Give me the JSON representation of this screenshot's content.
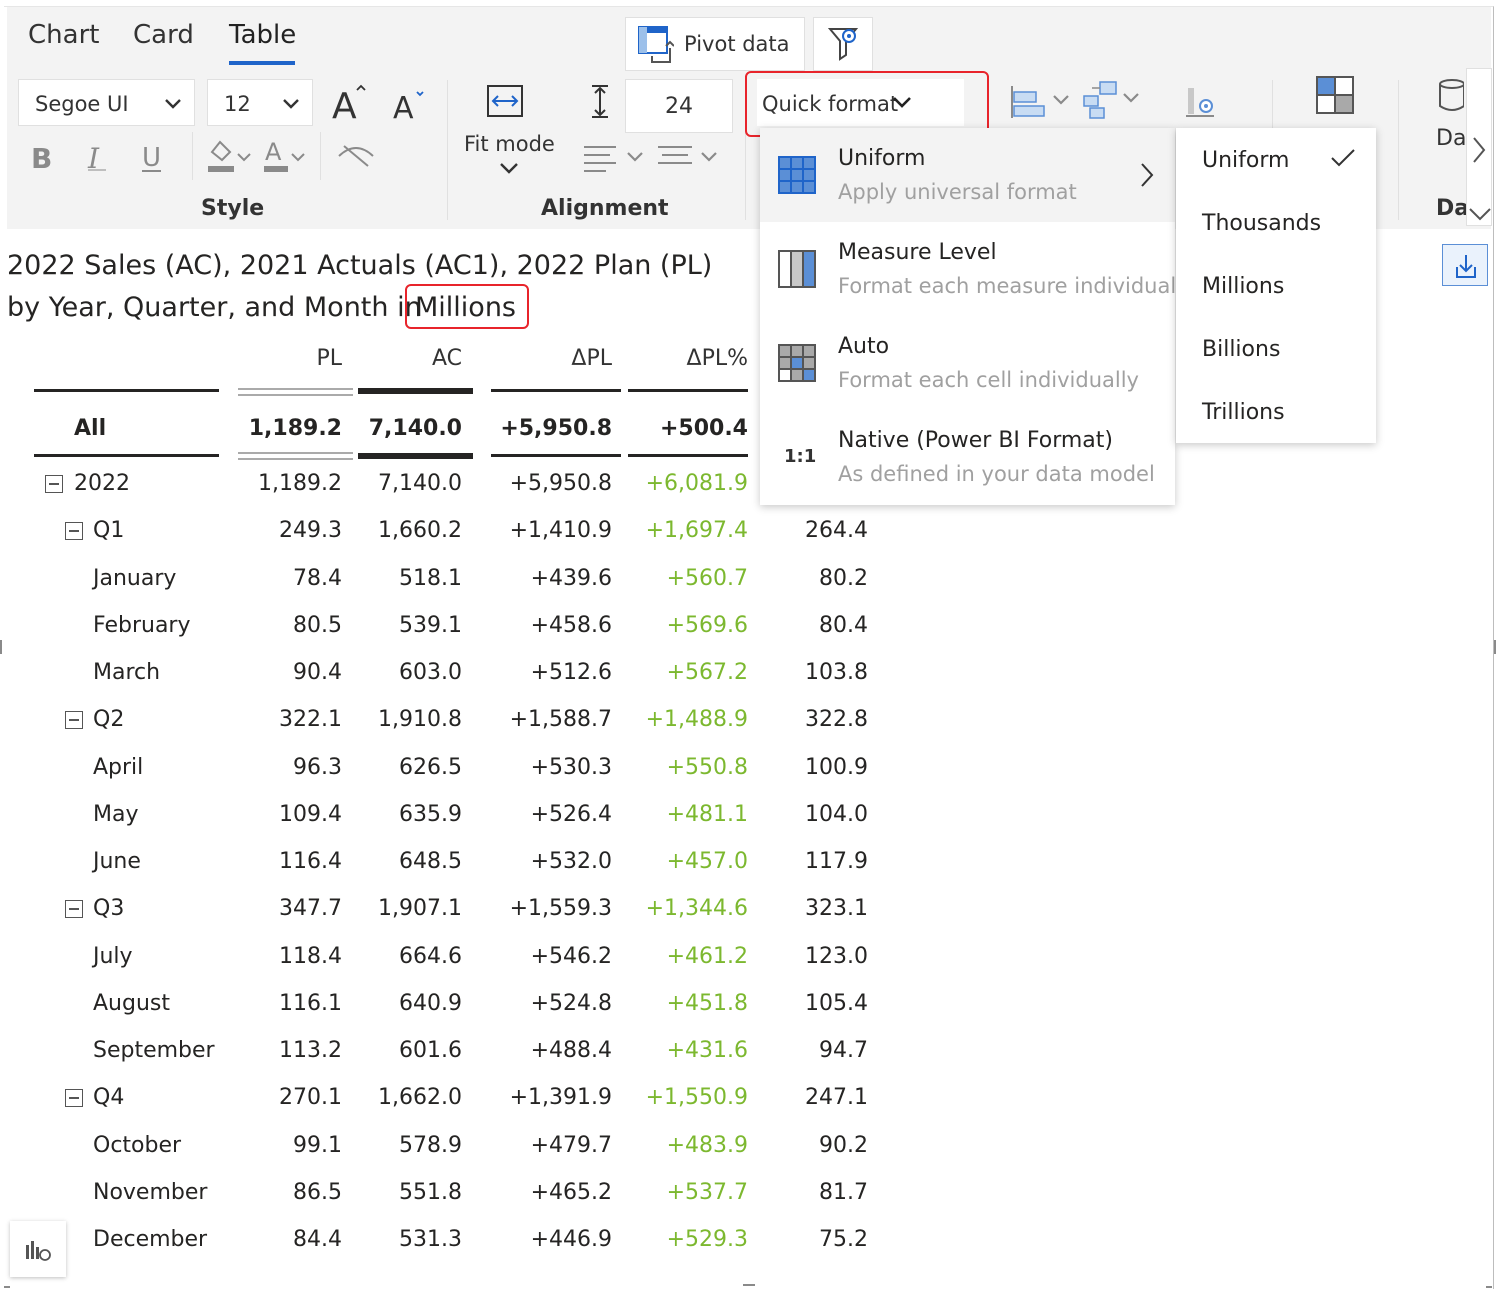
{
  "tabs": [
    "Chart",
    "Card",
    "Table"
  ],
  "active_tab": "Table",
  "toolbar": {
    "pivot_label": "Pivot  data",
    "font_family": "Segoe UI",
    "font_size": "12",
    "row_height": "24",
    "fit_mode_label": "Fit mode",
    "quick_format_label": "Quick format",
    "style_group": "Style",
    "alignment_group": "Alignment",
    "partial_label_1": "Da",
    "partial_label_2": "Da"
  },
  "title": {
    "line1": "2022 Sales (AC), 2021 Actuals (AC1), 2022 Plan (PL)",
    "line2": "by Year, Quarter, and Month in",
    "unit": "Millions"
  },
  "table": {
    "columns": [
      "PL",
      "AC",
      "ΔPL",
      "ΔPL%"
    ],
    "total": {
      "label": "All",
      "values": [
        "1,189.2",
        "7,140.0",
        "+5,950.8",
        "+500.4"
      ]
    },
    "rows": [
      {
        "label": "2022",
        "level": 0,
        "collapsible": true,
        "values": [
          "1,189.2",
          "7,140.0",
          "+5,950.8",
          "+6,081.9",
          ""
        ]
      },
      {
        "label": "Q1",
        "level": 1,
        "collapsible": true,
        "values": [
          "249.3",
          "1,660.2",
          "+1,410.9",
          "+1,697.4",
          "264.4"
        ]
      },
      {
        "label": "January",
        "level": 2,
        "values": [
          "78.4",
          "518.1",
          "+439.6",
          "+560.7",
          "80.2"
        ]
      },
      {
        "label": "February",
        "level": 2,
        "values": [
          "80.5",
          "539.1",
          "+458.6",
          "+569.6",
          "80.4"
        ]
      },
      {
        "label": "March",
        "level": 2,
        "values": [
          "90.4",
          "603.0",
          "+512.6",
          "+567.2",
          "103.8"
        ]
      },
      {
        "label": "Q2",
        "level": 1,
        "collapsible": true,
        "values": [
          "322.1",
          "1,910.8",
          "+1,588.7",
          "+1,488.9",
          "322.8"
        ]
      },
      {
        "label": "April",
        "level": 2,
        "values": [
          "96.3",
          "626.5",
          "+530.3",
          "+550.8",
          "100.9"
        ]
      },
      {
        "label": "May",
        "level": 2,
        "values": [
          "109.4",
          "635.9",
          "+526.4",
          "+481.1",
          "104.0"
        ]
      },
      {
        "label": "June",
        "level": 2,
        "values": [
          "116.4",
          "648.5",
          "+532.0",
          "+457.0",
          "117.9"
        ]
      },
      {
        "label": "Q3",
        "level": 1,
        "collapsible": true,
        "values": [
          "347.7",
          "1,907.1",
          "+1,559.3",
          "+1,344.6",
          "323.1"
        ]
      },
      {
        "label": "July",
        "level": 2,
        "values": [
          "118.4",
          "664.6",
          "+546.2",
          "+461.2",
          "123.0"
        ]
      },
      {
        "label": "August",
        "level": 2,
        "values": [
          "116.1",
          "640.9",
          "+524.8",
          "+451.8",
          "105.4"
        ]
      },
      {
        "label": "September",
        "level": 2,
        "values": [
          "113.2",
          "601.6",
          "+488.4",
          "+431.6",
          "94.7"
        ]
      },
      {
        "label": "Q4",
        "level": 1,
        "collapsible": true,
        "values": [
          "270.1",
          "1,662.0",
          "+1,391.9",
          "+1,550.9",
          "247.1"
        ]
      },
      {
        "label": "October",
        "level": 2,
        "values": [
          "99.1",
          "578.9",
          "+479.7",
          "+483.9",
          "90.2"
        ]
      },
      {
        "label": "November",
        "level": 2,
        "values": [
          "86.5",
          "551.8",
          "+465.2",
          "+537.7",
          "81.7"
        ]
      },
      {
        "label": "December",
        "level": 2,
        "values": [
          "84.4",
          "531.3",
          "+446.9",
          "+529.3",
          "75.2"
        ]
      }
    ]
  },
  "quick_format_menu": {
    "items": [
      {
        "title": "Uniform",
        "subtitle": "Apply universal format"
      },
      {
        "title": "Measure Level",
        "subtitle": "Format each measure individually"
      },
      {
        "title": "Auto",
        "subtitle": "Format each cell individually"
      },
      {
        "title": "Native (Power BI Format)",
        "subtitle": "As defined in your data model",
        "icon_text": "1:1"
      }
    ]
  },
  "uniform_submenu": {
    "items": [
      "Uniform",
      "Thousands",
      "Millions",
      "Billions",
      "Trillions"
    ],
    "checked": "Uniform"
  },
  "colors": {
    "accent": "#1f64c9",
    "highlight": "#e8242b",
    "positive": "#7cb82f"
  }
}
